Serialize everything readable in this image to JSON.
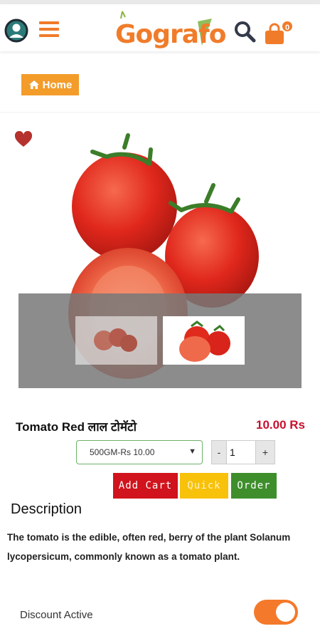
{
  "header": {
    "logo_text": "Gografo",
    "cart_count": "0"
  },
  "breadcrumb": {
    "home_label": "Home"
  },
  "product": {
    "name": "Tomato Red लाल टोमॅटो",
    "price": "10.00 Rs",
    "variant_selected": "500GM-Rs 10.00",
    "quantity": "1",
    "qty_minus": "-",
    "qty_plus": "+"
  },
  "actions": {
    "add_cart": "Add Cart",
    "quick": "Quick",
    "order": "Order"
  },
  "description": {
    "title": "Description",
    "text": "The tomato is the edible, often red, berry of the plant Solanum lycopersicum, commonly known as a tomato plant."
  },
  "settings": {
    "discount_label": "Discount Active",
    "discount_active": true
  },
  "colors": {
    "brand_orange": "#f07c2a",
    "price_red": "#c8102e",
    "add_cart_red": "#d0131c",
    "quick_yellow": "#f8c10a",
    "order_green": "#3e8e2c"
  },
  "icons": [
    "account-icon",
    "menu-icon",
    "search-icon",
    "cart-bag-icon",
    "home-icon",
    "heart-icon",
    "caret-down-icon"
  ]
}
